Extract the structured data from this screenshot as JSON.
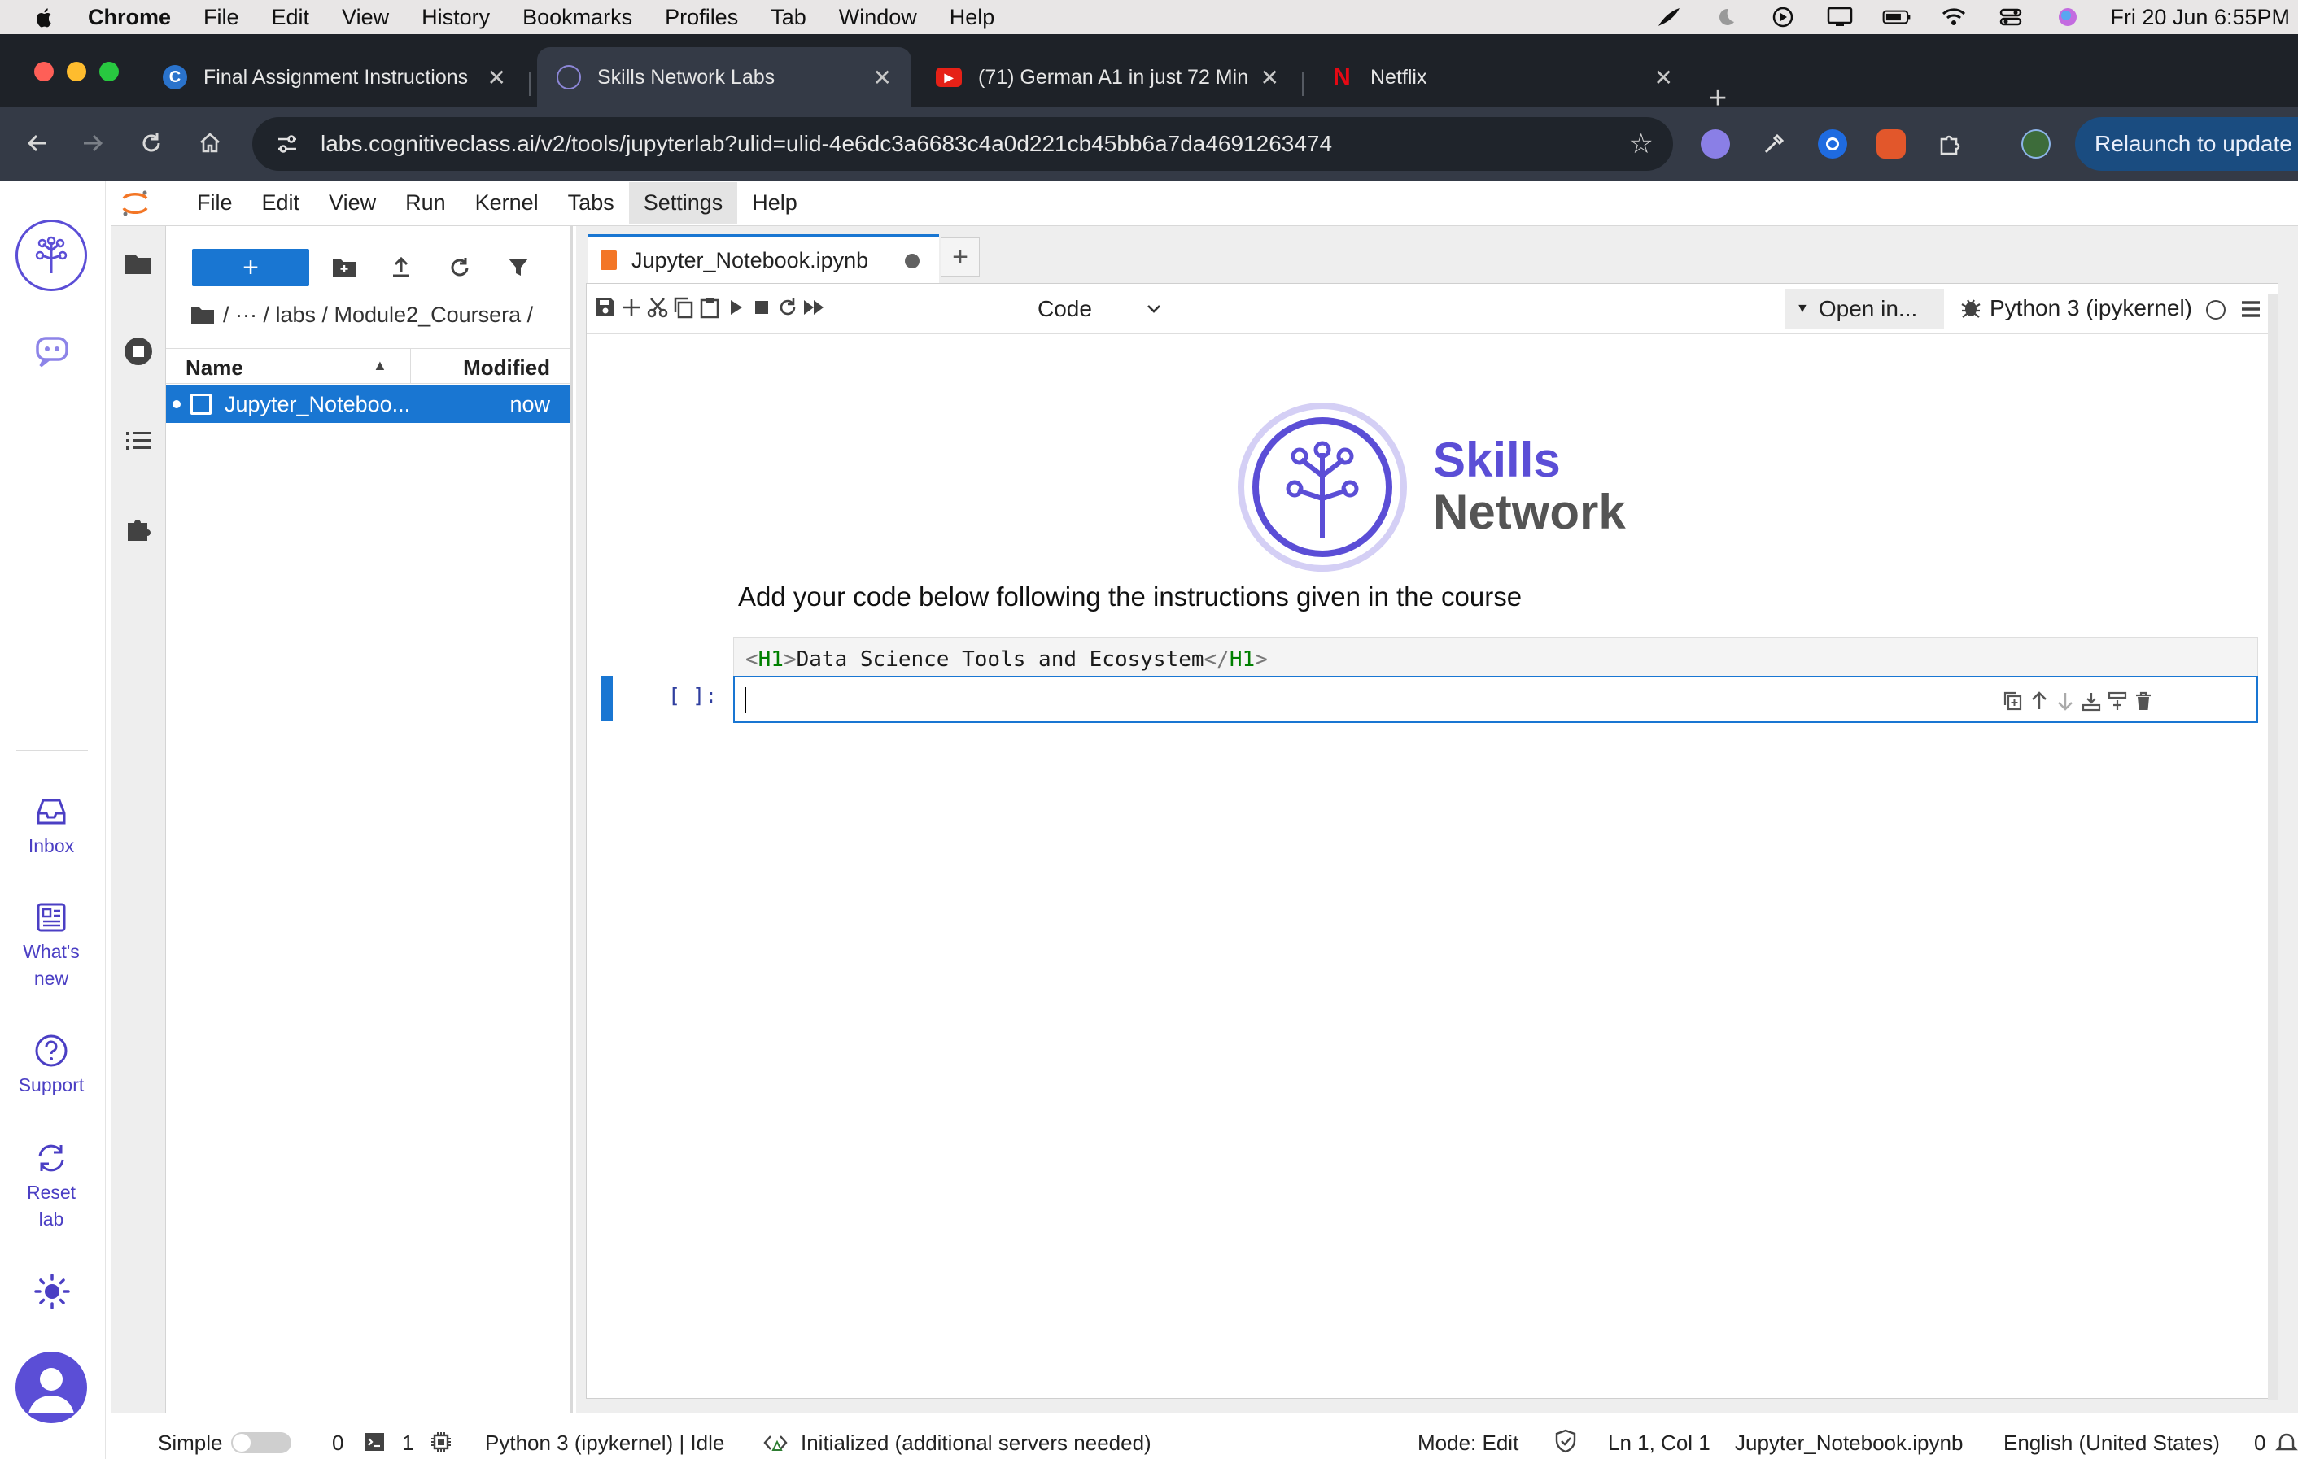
{
  "mac_menu": {
    "app": "Chrome",
    "items": [
      "File",
      "Edit",
      "View",
      "History",
      "Bookmarks",
      "Profiles",
      "Tab",
      "Window",
      "Help"
    ],
    "clock": "Fri 20 Jun  6:55PM"
  },
  "chrome": {
    "tabs": [
      {
        "title": "Final Assignment Instructions",
        "icon": "coursera-icon",
        "active": false
      },
      {
        "title": "Skills Network Labs",
        "icon": "skills-network-icon",
        "active": true
      },
      {
        "title": "(71) German A1 in just 72 Min",
        "icon": "youtube-icon",
        "active": false
      },
      {
        "title": "Netflix",
        "icon": "netflix-icon",
        "active": false
      }
    ],
    "close_glyph": "✕",
    "new_tab_glyph": "+",
    "url": "labs.cognitiveclass.ai/v2/tools/jupyterlab?ulid=ulid-4e6dc3a6683c4a0d221cb45bb6a7da4691263474",
    "relaunch_label": "Relaunch to update"
  },
  "sn_sidebar": {
    "items": [
      {
        "label": "Inbox",
        "icon": "inbox-icon"
      },
      {
        "label": "What's new",
        "icon": "newspaper-icon"
      },
      {
        "label": "Support",
        "icon": "question-icon"
      },
      {
        "label": "Reset lab",
        "icon": "reset-icon"
      }
    ]
  },
  "jupyter_menu": {
    "items": [
      "File",
      "Edit",
      "View",
      "Run",
      "Kernel",
      "Tabs",
      "Settings",
      "Help"
    ]
  },
  "file_browser": {
    "new_label": "+",
    "breadcrumb": "/  ···  / labs / Module2_Coursera /",
    "col_name": "Name",
    "col_modified": "Modified",
    "files": [
      {
        "name": "Jupyter_Noteboo...",
        "modified": "now"
      }
    ]
  },
  "notebook": {
    "tab_title": "Jupyter_Notebook.ipynb",
    "cell_type": "Code",
    "open_in": "Open in...",
    "kernel": "Python 3 (ipykernel)",
    "banner": {
      "skills": "Skills",
      "network": "Network"
    },
    "markdown_text": "Add your code below following the instructions given in the course",
    "raw_cell": {
      "open_lt": "<",
      "open_tag": "H1",
      "open_gt": ">",
      "content": "Data Science Tools and Ecosystem",
      "close_lt": "</",
      "close_tag": "H1",
      "close_gt": ">"
    },
    "prompt": "[ ]:"
  },
  "status_bar": {
    "mode_label": "Simple",
    "terminals": "0",
    "kernels": "1",
    "kernel_status": "Python 3 (ipykernel) | Idle",
    "lsp": "Initialized (additional servers needed)",
    "mode": "Mode: Edit",
    "position": "Ln 1, Col 1",
    "filename": "Jupyter_Notebook.ipynb",
    "language": "English (United States)",
    "notifications": "0"
  },
  "colors": {
    "accent": "#1976d2",
    "brand_purple": "#5b4ed6",
    "chrome_dark": "#1e2228"
  }
}
